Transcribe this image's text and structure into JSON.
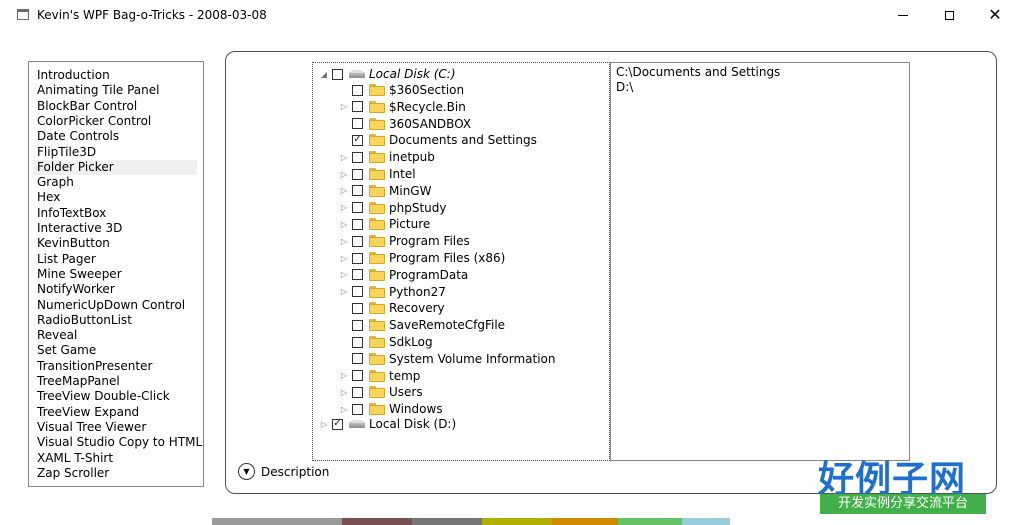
{
  "window": {
    "title": "Kevin's WPF Bag-o-Tricks - 2008-03-08"
  },
  "nav": {
    "items": [
      "Introduction",
      "Animating Tile Panel",
      "BlockBar Control",
      "ColorPicker Control",
      "Date Controls",
      "FlipTile3D",
      "Folder Picker",
      "Graph",
      "Hex",
      "InfoTextBox",
      "Interactive 3D",
      "KevinButton",
      "List Pager",
      "Mine Sweeper",
      "NotifyWorker",
      "NumericUpDown Control",
      "RadioButtonList",
      "Reveal",
      "Set Game",
      "TransitionPresenter",
      "TreeMapPanel",
      "TreeView Double-Click",
      "TreeView Expand",
      "Visual Tree Viewer",
      "Visual Studio Copy to HTML",
      "XAML T-Shirt",
      "Zap Scroller"
    ],
    "selected_index": 6
  },
  "tree": {
    "root_c": {
      "label": "Local Disk (C:)",
      "expanded": true,
      "checked": false
    },
    "children": [
      {
        "label": "$360Section",
        "has_children": false,
        "checked": false
      },
      {
        "label": "$Recycle.Bin",
        "has_children": true,
        "checked": false
      },
      {
        "label": "360SANDBOX",
        "has_children": false,
        "checked": false
      },
      {
        "label": "Documents and Settings",
        "has_children": false,
        "checked": true
      },
      {
        "label": "inetpub",
        "has_children": true,
        "checked": false
      },
      {
        "label": "Intel",
        "has_children": true,
        "checked": false
      },
      {
        "label": "MinGW",
        "has_children": true,
        "checked": false
      },
      {
        "label": "phpStudy",
        "has_children": true,
        "checked": false
      },
      {
        "label": "Picture",
        "has_children": true,
        "checked": false
      },
      {
        "label": "Program Files",
        "has_children": true,
        "checked": false
      },
      {
        "label": "Program Files (x86)",
        "has_children": true,
        "checked": false
      },
      {
        "label": "ProgramData",
        "has_children": true,
        "checked": false
      },
      {
        "label": "Python27",
        "has_children": true,
        "checked": false
      },
      {
        "label": "Recovery",
        "has_children": false,
        "checked": false
      },
      {
        "label": "SaveRemoteCfgFile",
        "has_children": false,
        "checked": false
      },
      {
        "label": "SdkLog",
        "has_children": false,
        "checked": false
      },
      {
        "label": "System Volume Information",
        "has_children": false,
        "checked": false
      },
      {
        "label": "temp",
        "has_children": true,
        "checked": false
      },
      {
        "label": "Users",
        "has_children": true,
        "checked": false
      },
      {
        "label": "Windows",
        "has_children": true,
        "checked": false
      }
    ],
    "root_d": {
      "label": "Local Disk (D:)",
      "expanded": false,
      "checked": true
    }
  },
  "selected_paths": [
    "C:\\Documents and Settings",
    "D:\\"
  ],
  "expander": {
    "label": "Description",
    "icon": "chevron-down-icon"
  },
  "watermark": {
    "big": "好例子网",
    "small": "开发实例分享交流平台"
  },
  "colors": {
    "folder": "#f7d45a",
    "border": "#828790",
    "selected_bg": "#f0f0f0",
    "watermark_blue": "#1e6fd0",
    "watermark_green": "#42b04a"
  }
}
